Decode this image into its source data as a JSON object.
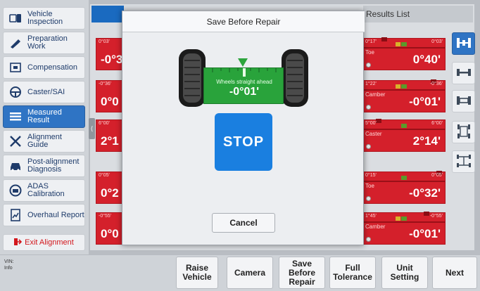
{
  "sidebar": {
    "items": [
      {
        "label": "Vehicle Inspection",
        "icon": "vehicle-inspection-icon"
      },
      {
        "label": "Preparation Work",
        "icon": "wrench-icon"
      },
      {
        "label": "Compensation",
        "icon": "compensation-icon"
      },
      {
        "label": "Caster/SAI",
        "icon": "steering-wheel-icon"
      },
      {
        "label": "Measured Result",
        "icon": "list-icon",
        "active": true
      },
      {
        "label": "Alignment Guide",
        "icon": "tools-icon"
      },
      {
        "label": "Post-alignment Diagnosis",
        "icon": "car-icon"
      },
      {
        "label": "ADAS Calibration",
        "icon": "adas-icon"
      },
      {
        "label": "Overhaul Report",
        "icon": "report-icon"
      }
    ],
    "exit_label": "Exit Alignment"
  },
  "header": {
    "results_title": "Results List"
  },
  "left_cards": [
    {
      "limit": "0°03'",
      "value": "-0°3"
    },
    {
      "limit": "-0°36'",
      "value": "0°0"
    },
    {
      "limit": "6°00'",
      "value": "2°1"
    },
    {
      "limit": "0°05'",
      "value": "0°2"
    },
    {
      "limit": "-0°55'",
      "value": "0°0"
    }
  ],
  "right_cards": [
    {
      "lim_left": "0°17'",
      "lim_right": "0°03'",
      "name": "Toe",
      "value": "0°40'"
    },
    {
      "lim_left": "1°22'",
      "lim_right": "-0°36'",
      "name": "Camber",
      "value": "-0°01'"
    },
    {
      "lim_left": "5°00'",
      "lim_right": "6°00'",
      "name": "Caster",
      "value": "2°14'"
    },
    {
      "lim_left": "0°15'",
      "lim_right": "0°05'",
      "name": "Toe",
      "value": "-0°32'"
    },
    {
      "lim_left": "1°45'",
      "lim_right": "-0°55'",
      "name": "Camber",
      "value": "-0°01'"
    }
  ],
  "footer": {
    "vin_label": "VIN:",
    "info_label": "Info",
    "buttons": [
      "Raise Vehicle",
      "Camera",
      "Save Before Repair",
      "Full Tolerance",
      "Unit Setting",
      "Next"
    ]
  },
  "modal": {
    "title": "Save Before Repair",
    "indicator_label": "Wheels straight ahead",
    "indicator_value": "-0°01'",
    "stop_label": "STOP",
    "cancel_label": "Cancel"
  },
  "colors": {
    "accent": "#2f74c4",
    "alert_red": "#d4202b",
    "ok_green": "#29a33b",
    "stop_blue": "#1a7fe0",
    "exit_red": "#d2171d"
  }
}
